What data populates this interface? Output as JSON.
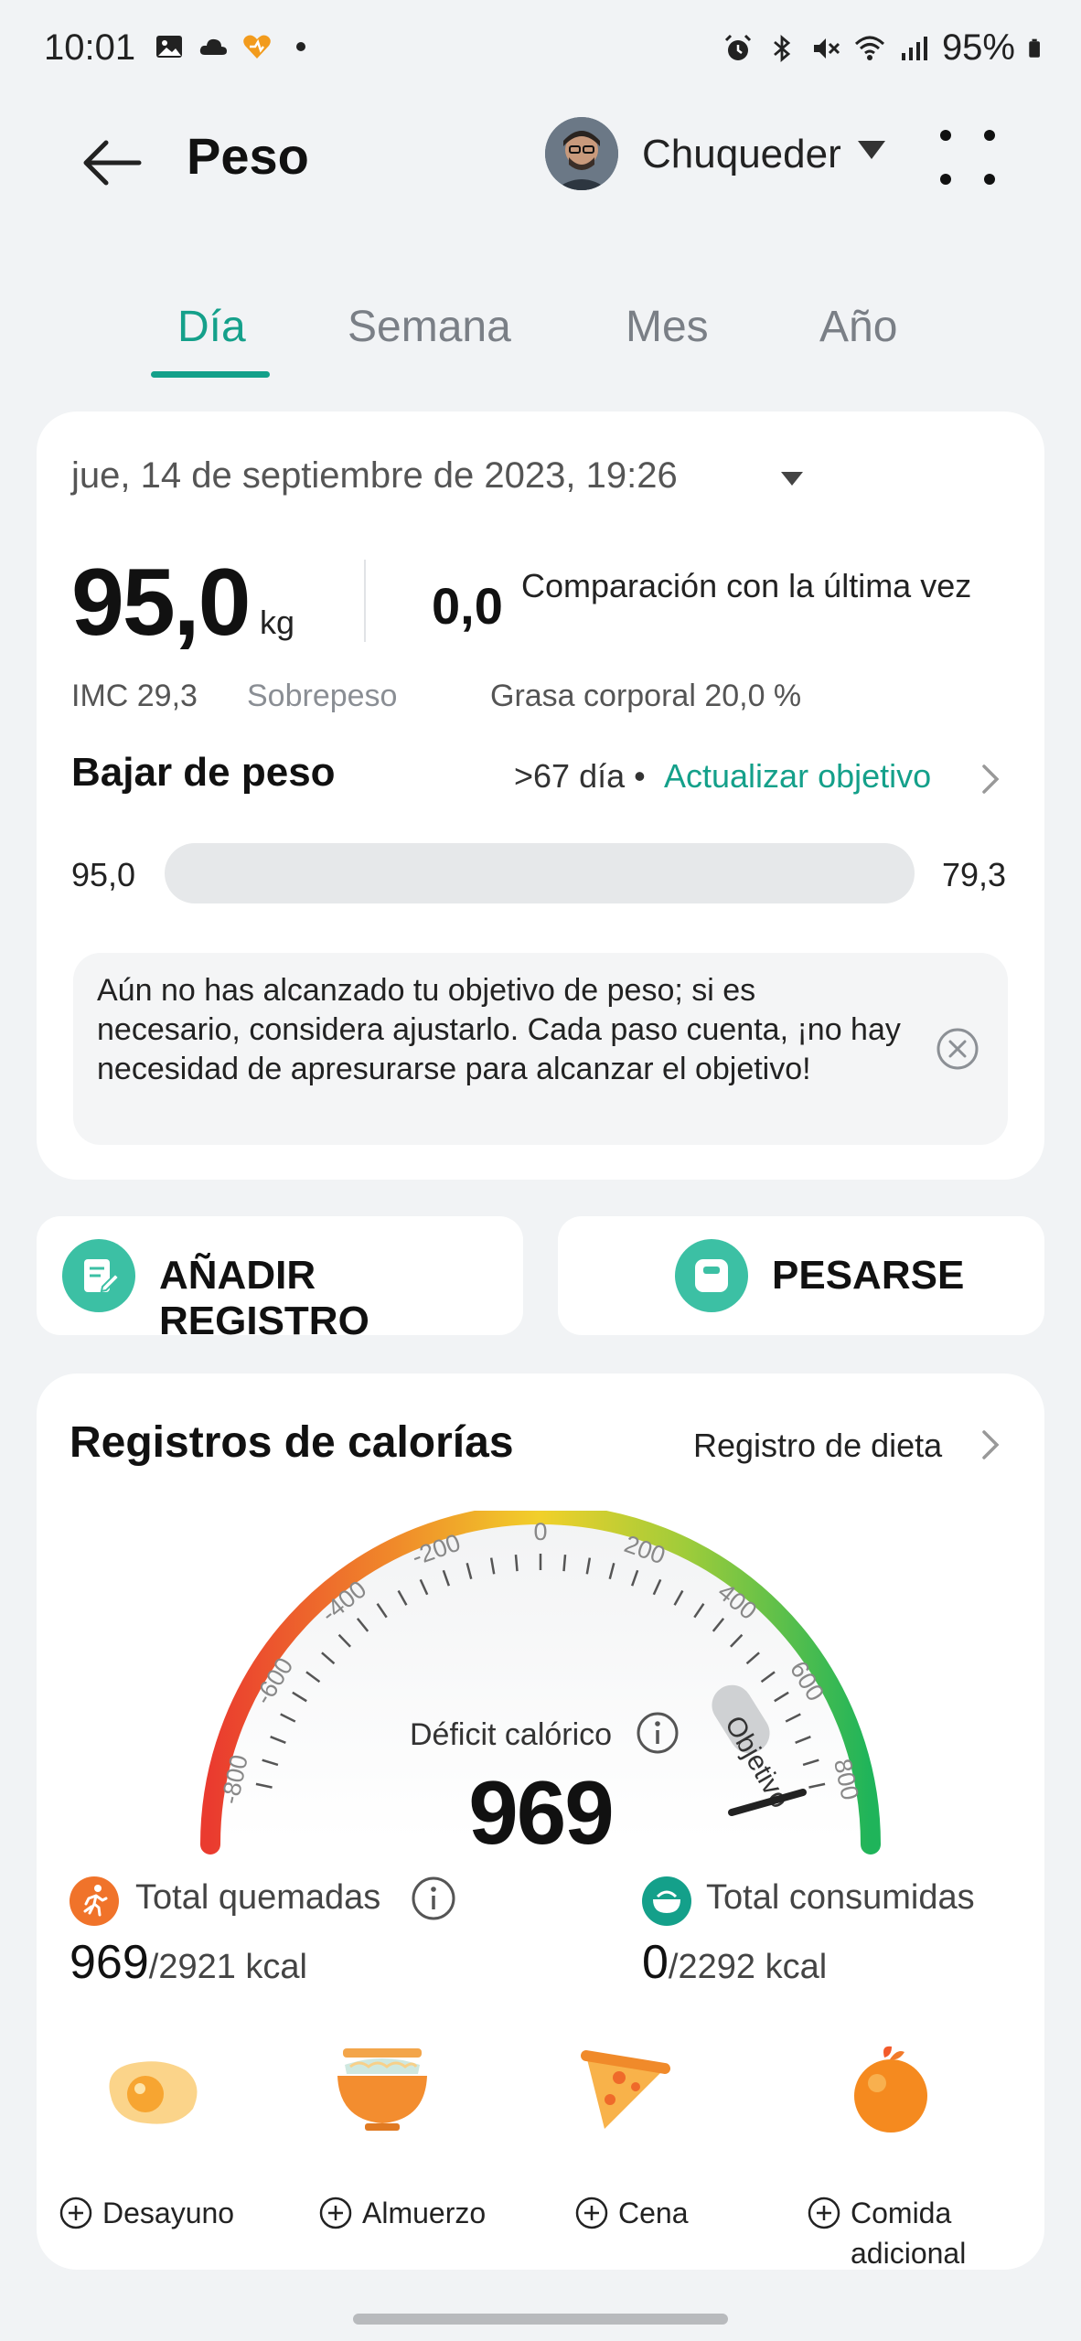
{
  "status_bar": {
    "time": "10:01",
    "battery": "95%",
    "left_icons": [
      "gallery-icon",
      "cloud-icon",
      "health-app-icon",
      "dot-icon"
    ],
    "right_icons": [
      "alarm-icon",
      "bluetooth-icon",
      "mute-icon",
      "wifi-icon",
      "signal-icon",
      "battery-icon"
    ]
  },
  "header": {
    "title": "Peso",
    "user_name": "Chuqueder"
  },
  "tabs": [
    {
      "label": "Día",
      "active": true
    },
    {
      "label": "Semana",
      "active": false
    },
    {
      "label": "Mes",
      "active": false
    },
    {
      "label": "Año",
      "active": false
    }
  ],
  "weight_card": {
    "datetime": "jue, 14 de septiembre de 2023, 19:26",
    "weight": "95,0",
    "unit": "kg",
    "difference": "0,0",
    "difference_label": "Comparación con la última vez",
    "imc": "IMC 29,3",
    "imc_status": "Sobrepeso",
    "body_fat": "Grasa corporal 20,0 %",
    "goal_title": "Bajar de peso",
    "goal_days": ">67 día •",
    "goal_link": "Actualizar objetivo",
    "progress_start": "95,0",
    "progress_end": "79,3",
    "progress_fraction": 0,
    "tip": "Aún no has alcanzado tu objetivo de peso; si es necesario, considera ajustarlo. Cada paso cuenta, ¡no hay necesidad de apresurarse para alcanzar el objetivo!"
  },
  "actions": {
    "add_record": "AÑADIR REGISTRO",
    "weigh": "PESARSE"
  },
  "calories_card": {
    "title": "Registros de calorías",
    "diet_link": "Registro de dieta",
    "gauge_ticks": [
      "-800",
      "-600",
      "-400",
      "-200",
      "0",
      "200",
      "400",
      "600",
      "800"
    ],
    "gauge_goal_label": "Objetivo",
    "deficit_label": "Déficit calórico",
    "deficit_value": "969",
    "burned_label": "Total quemadas",
    "burned_value": "969",
    "burned_total": "/2921 kcal",
    "consumed_label": "Total consumidas",
    "consumed_value": "0",
    "consumed_total": "/2292 kcal",
    "meals": [
      {
        "label": "Desayuno",
        "icon": "egg-icon"
      },
      {
        "label": "Almuerzo",
        "icon": "bowl-icon"
      },
      {
        "label": "Cena",
        "icon": "pizza-icon"
      },
      {
        "label": "Comida adicional",
        "icon": "orange-icon"
      }
    ],
    "colors": {
      "accent": "#14a08a",
      "burn": "#f0732a"
    }
  }
}
